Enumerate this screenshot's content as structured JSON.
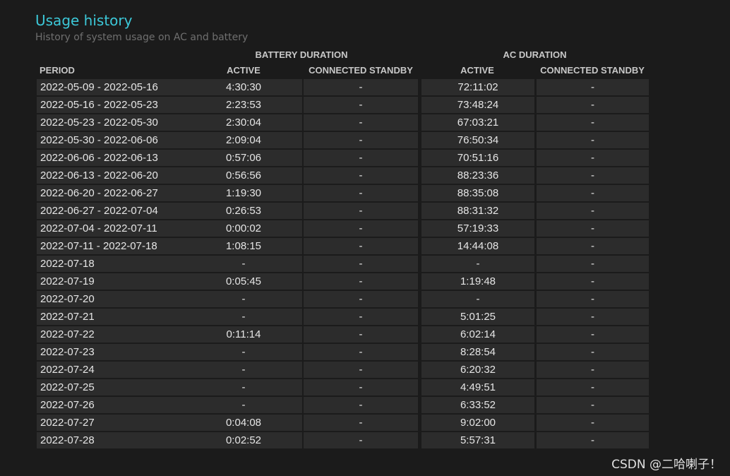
{
  "header": {
    "title": "Usage history",
    "subtitle": "History of system usage on AC and battery"
  },
  "groups": {
    "battery": "BATTERY DURATION",
    "ac": "AC DURATION"
  },
  "columns": {
    "period": "PERIOD",
    "battery_active": "ACTIVE",
    "battery_standby": "CONNECTED STANDBY",
    "ac_active": "ACTIVE",
    "ac_standby": "CONNECTED STANDBY"
  },
  "rows": [
    {
      "period": "2022-05-09 - 2022-05-16",
      "battery_active": "4:30:30",
      "battery_standby": "-",
      "ac_active": "72:11:02",
      "ac_standby": "-"
    },
    {
      "period": "2022-05-16 - 2022-05-23",
      "battery_active": "2:23:53",
      "battery_standby": "-",
      "ac_active": "73:48:24",
      "ac_standby": "-"
    },
    {
      "period": "2022-05-23 - 2022-05-30",
      "battery_active": "2:30:04",
      "battery_standby": "-",
      "ac_active": "67:03:21",
      "ac_standby": "-"
    },
    {
      "period": "2022-05-30 - 2022-06-06",
      "battery_active": "2:09:04",
      "battery_standby": "-",
      "ac_active": "76:50:34",
      "ac_standby": "-"
    },
    {
      "period": "2022-06-06 - 2022-06-13",
      "battery_active": "0:57:06",
      "battery_standby": "-",
      "ac_active": "70:51:16",
      "ac_standby": "-"
    },
    {
      "period": "2022-06-13 - 2022-06-20",
      "battery_active": "0:56:56",
      "battery_standby": "-",
      "ac_active": "88:23:36",
      "ac_standby": "-"
    },
    {
      "period": "2022-06-20 - 2022-06-27",
      "battery_active": "1:19:30",
      "battery_standby": "-",
      "ac_active": "88:35:08",
      "ac_standby": "-"
    },
    {
      "period": "2022-06-27 - 2022-07-04",
      "battery_active": "0:26:53",
      "battery_standby": "-",
      "ac_active": "88:31:32",
      "ac_standby": "-"
    },
    {
      "period": "2022-07-04 - 2022-07-11",
      "battery_active": "0:00:02",
      "battery_standby": "-",
      "ac_active": "57:19:33",
      "ac_standby": "-"
    },
    {
      "period": "2022-07-11 - 2022-07-18",
      "battery_active": "1:08:15",
      "battery_standby": "-",
      "ac_active": "14:44:08",
      "ac_standby": "-"
    },
    {
      "period": "2022-07-18",
      "battery_active": "-",
      "battery_standby": "-",
      "ac_active": "-",
      "ac_standby": "-"
    },
    {
      "period": "2022-07-19",
      "battery_active": "0:05:45",
      "battery_standby": "-",
      "ac_active": "1:19:48",
      "ac_standby": "-"
    },
    {
      "period": "2022-07-20",
      "battery_active": "-",
      "battery_standby": "-",
      "ac_active": "-",
      "ac_standby": "-"
    },
    {
      "period": "2022-07-21",
      "battery_active": "-",
      "battery_standby": "-",
      "ac_active": "5:01:25",
      "ac_standby": "-"
    },
    {
      "period": "2022-07-22",
      "battery_active": "0:11:14",
      "battery_standby": "-",
      "ac_active": "6:02:14",
      "ac_standby": "-"
    },
    {
      "period": "2022-07-23",
      "battery_active": "-",
      "battery_standby": "-",
      "ac_active": "8:28:54",
      "ac_standby": "-"
    },
    {
      "period": "2022-07-24",
      "battery_active": "-",
      "battery_standby": "-",
      "ac_active": "6:20:32",
      "ac_standby": "-"
    },
    {
      "period": "2022-07-25",
      "battery_active": "-",
      "battery_standby": "-",
      "ac_active": "4:49:51",
      "ac_standby": "-"
    },
    {
      "period": "2022-07-26",
      "battery_active": "-",
      "battery_standby": "-",
      "ac_active": "6:33:52",
      "ac_standby": "-"
    },
    {
      "period": "2022-07-27",
      "battery_active": "0:04:08",
      "battery_standby": "-",
      "ac_active": "9:02:00",
      "ac_standby": "-"
    },
    {
      "period": "2022-07-28",
      "battery_active": "0:02:52",
      "battery_standby": "-",
      "ac_active": "5:57:31",
      "ac_standby": "-"
    }
  ],
  "watermark": "CSDN @二哈喇子！",
  "colors": {
    "title": "#3cc8d8",
    "subtitle": "#6f6f6f",
    "background": "#1b1b1b",
    "cell_background": "#2c2c2c"
  }
}
